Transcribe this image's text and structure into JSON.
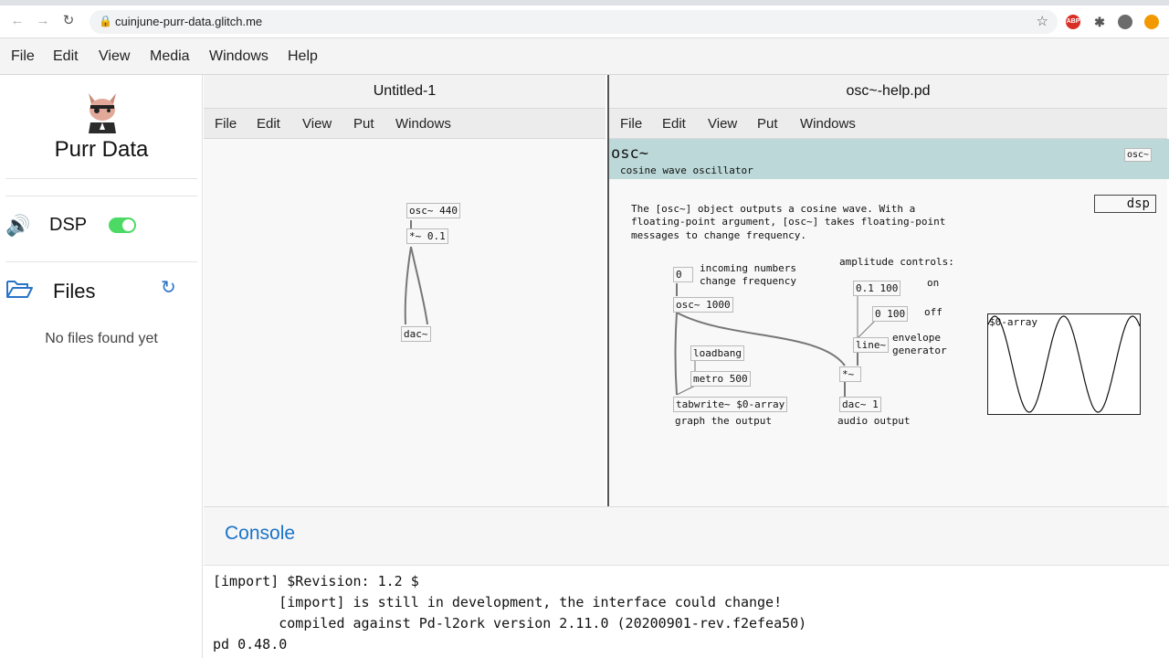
{
  "browser": {
    "url": "cuinjune-purr-data.glitch.me",
    "ext_abp": "ABP"
  },
  "app_menu": [
    "File",
    "Edit",
    "View",
    "Media",
    "Windows",
    "Help"
  ],
  "sidebar": {
    "app_name": "Purr Data",
    "dsp_label": "DSP",
    "dsp_on": true,
    "files_label": "Files",
    "no_files": "No files found yet"
  },
  "windows": [
    {
      "title": "Untitled-1",
      "menu": [
        "File",
        "Edit",
        "View",
        "Put",
        "Windows"
      ],
      "objects": [
        "osc~ 440",
        "*~ 0.1",
        "dac~"
      ]
    },
    {
      "title": "osc~-help.pd",
      "menu": [
        "File",
        "Edit",
        "View",
        "Put",
        "Windows"
      ],
      "header_name": "osc~",
      "header_sub": "cosine wave oscillator",
      "header_obj": "osc~",
      "dsp_box": "dsp",
      "desc": [
        "The [osc~] object outputs a cosine wave. With a",
        "floating-point argument, [osc~] takes floating-point",
        "messages to change frequency."
      ],
      "number_box": "0",
      "incoming": [
        "incoming numbers",
        "change frequency"
      ],
      "amp_label": "amplitude controls:",
      "msg_on": "0.1 100",
      "msg_off": "0 100",
      "on_label": "on",
      "off_label": "off",
      "osc_obj": "osc~ 1000",
      "loadbang": "loadbang",
      "metro": "metro 500",
      "tabwrite": "tabwrite~ $0-array",
      "graph_label": "graph the output",
      "line_obj": "line~",
      "envelope": [
        "envelope",
        "generator"
      ],
      "mult_obj": "*~",
      "dac_obj": "dac~ 1",
      "audio_label": "audio output",
      "array_name": "$0-array"
    }
  ],
  "console": {
    "title": "Console",
    "lines": [
      "[import] $Revision: 1.2 $",
      "        [import] is still in development, the interface could change!",
      "        compiled against Pd-l2ork version 2.11.0 (20200901-rev.f2efea50)",
      "pd 0.48.0"
    ]
  },
  "colors": {
    "accent": "#1a73c8",
    "toggle_on": "#4cd964",
    "help_header": "#bcd8d8"
  }
}
